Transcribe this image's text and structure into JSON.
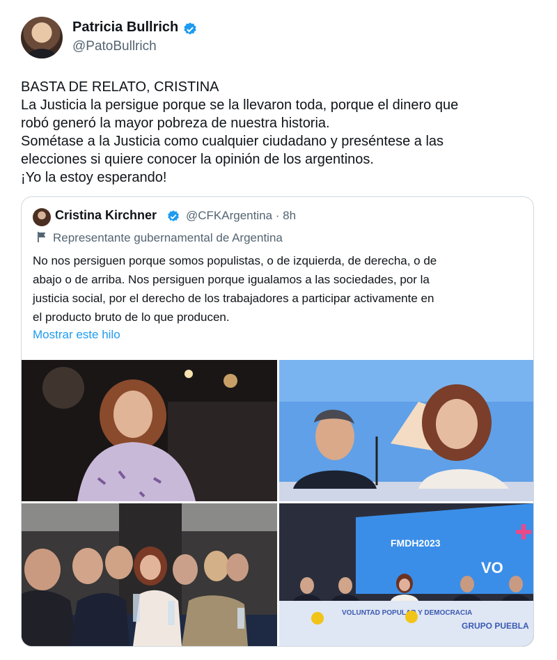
{
  "author": {
    "name": "Patricia Bullrich",
    "handle": "@PatoBullrich"
  },
  "tweet": {
    "lines": [
      "BASTA DE RELATO, CRISTINA",
      "La Justicia la persigue porque se la llevaron toda, porque el dinero que",
      "robó generó la mayor pobreza de nuestra historia.",
      "Sométase a la Justicia como cualquier ciudadano y preséntese a las",
      "elecciones si quiere conocer la opinión de los argentinos.",
      "¡Yo la estoy esperando!"
    ]
  },
  "quote": {
    "name": "Cristina Kirchner",
    "handle": "@CFKArgentina",
    "time": "8h",
    "label": "Representante gubernamental de Argentina",
    "lines": [
      "No nos persiguen porque somos populistas, o de izquierda, de derecha, o de",
      "abajo o de arriba. Nos persiguen porque igualamos a las sociedades, por la",
      "justicia social, por el derecho de los trabajadores a participar activamente en",
      "el producto bruto de lo que producen."
    ],
    "link": "Mostrar este hilo",
    "photo4_banner": "FMDH2023",
    "photo4_banner2": "VO",
    "photo4_table": "VOLUNTAD POPULAR Y DEMOCRACIA",
    "photo4_logo": "GRUPO PUEBLA"
  },
  "colors": {
    "verified": "#1d9bf0",
    "link": "#1d9bf0",
    "muted": "#536471"
  }
}
